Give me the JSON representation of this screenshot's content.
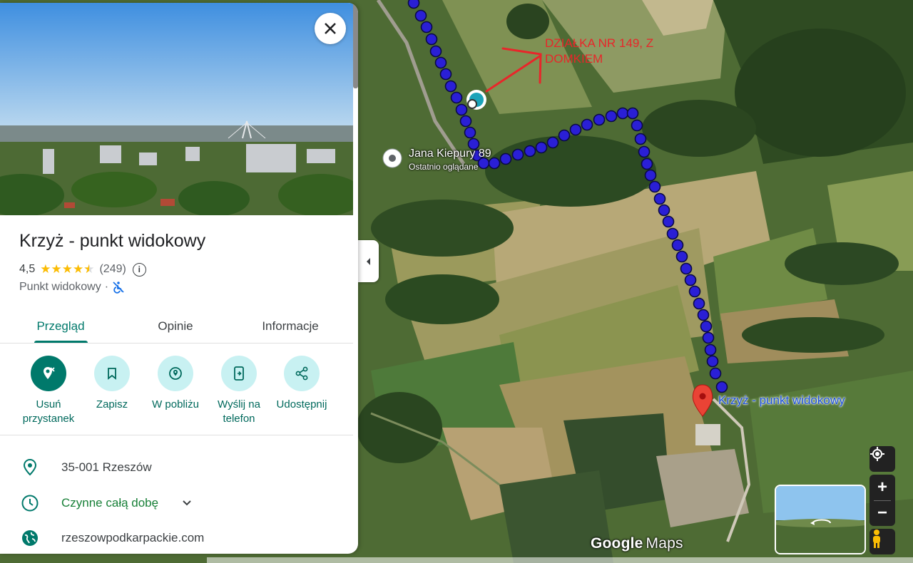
{
  "map": {
    "labels": {
      "recent_place_title": "Jana Kiepury 89",
      "recent_place_sub": "Ostatnio oglądane",
      "pin_label": "Krzyż - punkt widokowy",
      "annotation_line1": "DZIAŁKA NR 149, Z",
      "annotation_line2": "DOMKIEM"
    },
    "logo": {
      "google": "Google",
      "maps": "Maps"
    },
    "controls": {
      "locate_icon": "crosshair-icon",
      "zoom_in": "+",
      "zoom_out": "−",
      "pegman_icon": "pegman-icon"
    },
    "colors": {
      "route": "#2a1fd6",
      "annotation": "#e8262a",
      "pin": "#ea4335",
      "pin_label": "#1a4fd8"
    }
  },
  "panel": {
    "title": "Krzyż - punkt widokowy",
    "rating": "4,5",
    "stars": "★★★★",
    "half_star": "★",
    "review_count": "(249)",
    "info_symbol": "i",
    "category": "Punkt widokowy",
    "category_dot": "·",
    "tabs": [
      {
        "label": "Przegląd",
        "active": true
      },
      {
        "label": "Opinie",
        "active": false
      },
      {
        "label": "Informacje",
        "active": false
      }
    ],
    "actions": [
      {
        "label": "Usuń przystanek",
        "icon": "remove-stop-icon"
      },
      {
        "label": "Zapisz",
        "icon": "bookmark-icon"
      },
      {
        "label": "W pobliżu",
        "icon": "nearby-icon"
      },
      {
        "label": "Wyślij na telefon",
        "icon": "send-to-phone-icon"
      },
      {
        "label": "Udostępnij",
        "icon": "share-icon"
      }
    ],
    "details": [
      {
        "text": "35-001 Rzeszów",
        "icon": "location-pin-icon"
      },
      {
        "text": "Czynne całą dobę",
        "icon": "clock-icon"
      },
      {
        "text": "rzeszowpodkarpackie.com",
        "icon": "globe-icon"
      }
    ],
    "accent": "#00796b"
  }
}
